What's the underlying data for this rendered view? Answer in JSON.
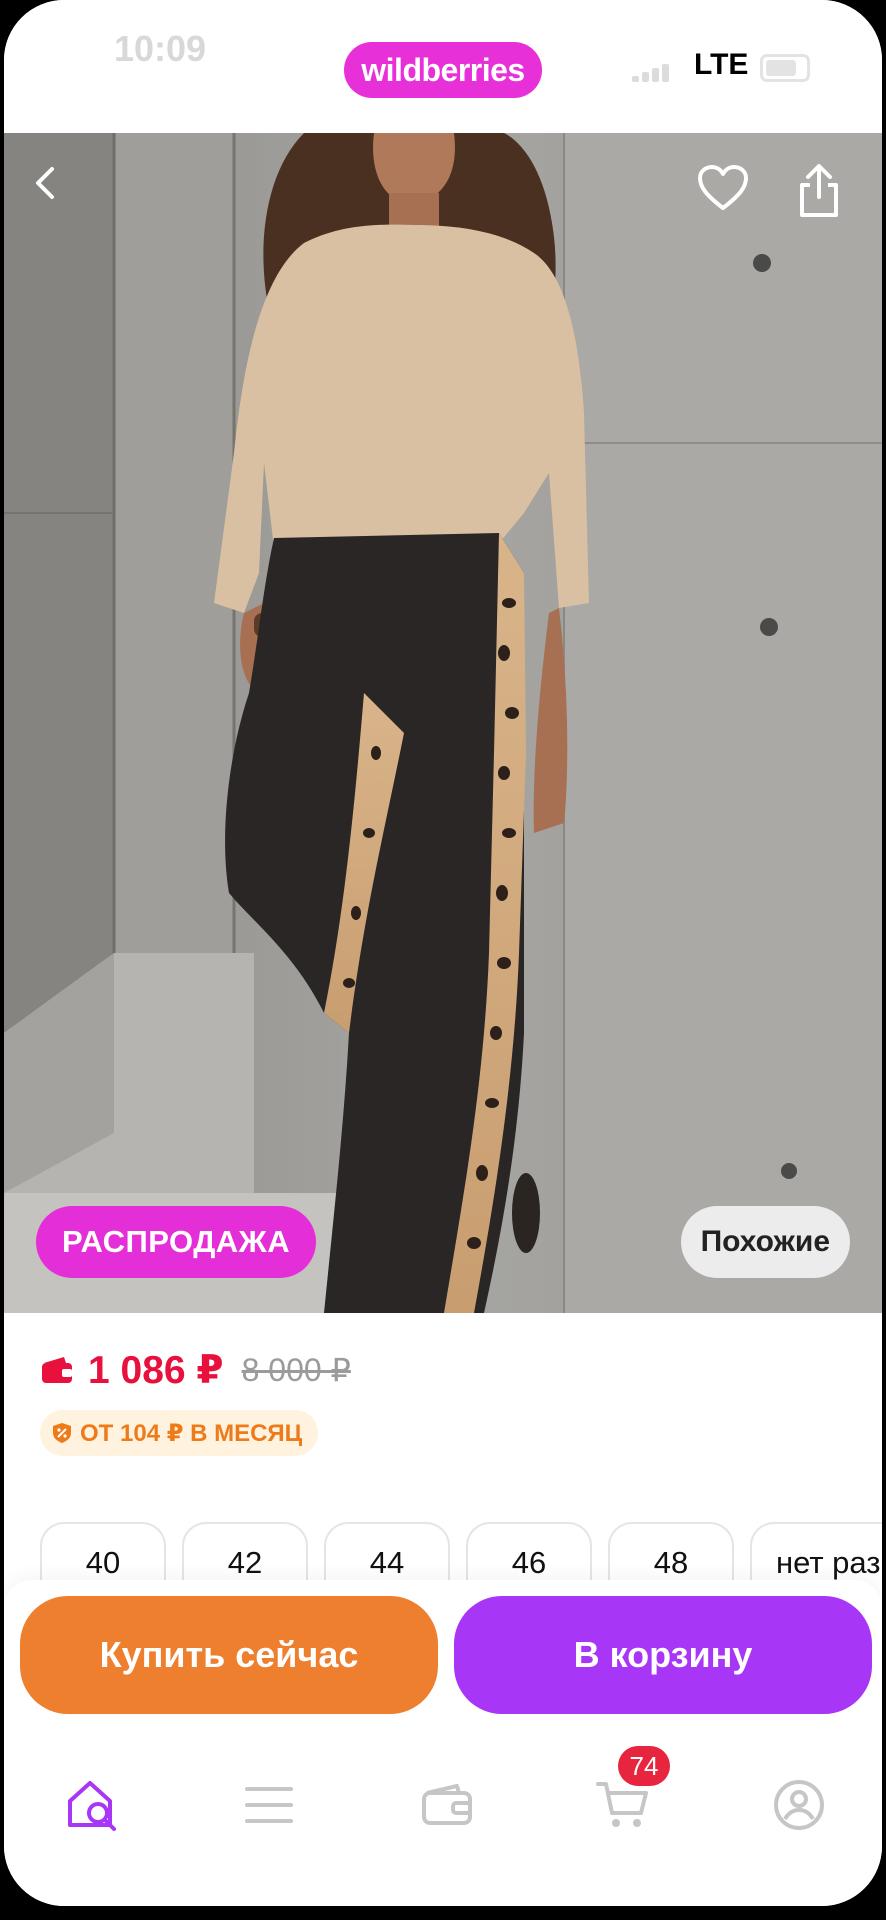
{
  "status_bar": {
    "time": "10:09",
    "network": "LTE"
  },
  "header": {
    "logo_text": "wildberries"
  },
  "product": {
    "sale_label": "РАСПРОДАЖА",
    "similar_label": "Похожие",
    "price_current": "1 086 ₽",
    "price_old": "8 000 ₽",
    "installment": "ОТ 104 ₽ В МЕСЯЦ",
    "sizes": [
      "40",
      "42",
      "44",
      "46",
      "48",
      "нет раз"
    ]
  },
  "actions": {
    "buy_now": "Купить сейчас",
    "add_to_cart": "В корзину"
  },
  "tab_bar": {
    "cart_count": "74",
    "items": [
      "home-search-icon",
      "catalog-icon",
      "wallet-icon",
      "cart-icon",
      "profile-icon"
    ]
  },
  "colors": {
    "brand": "#e42fd8",
    "price": "#e8103c",
    "buy_now": "#ee7f2e",
    "add_to_cart": "#a736f6",
    "installment": "#ed7b1a"
  }
}
